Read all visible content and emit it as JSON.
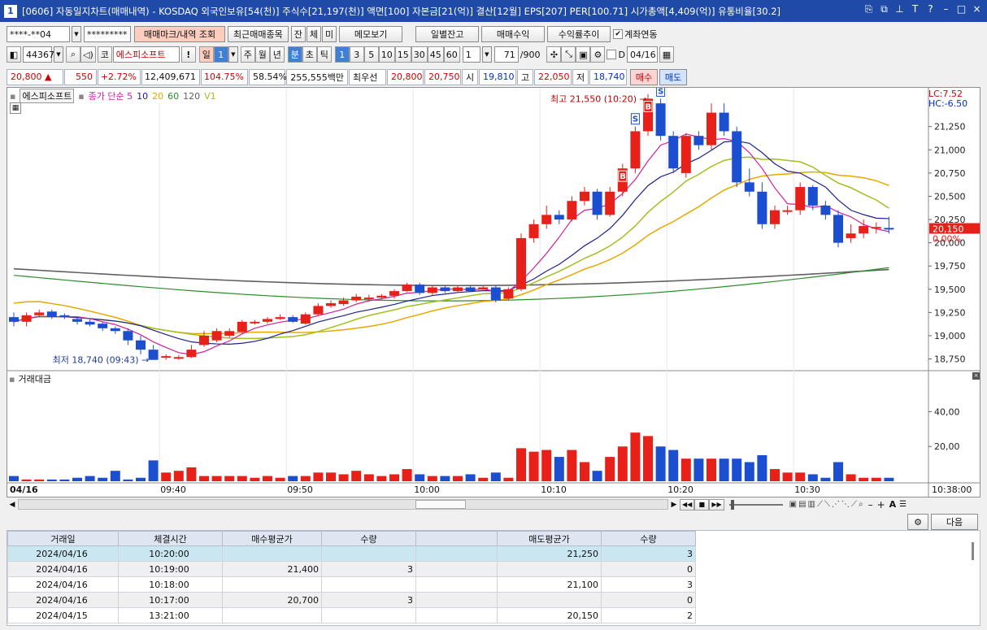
{
  "window": {
    "title": "[0606] 자동일지차트(매매내역) - KOSDAQ 외국인보유[54(천)] 주식수[21,197(천)] 액면[100] 자본금[21(억)] 결산[12월] EPS[207] PER[100.71] 시가총액[4,409(억)] 유통비율[30.2]",
    "num": "1",
    "ctl": [
      "⎘",
      "⧉",
      "⊥",
      "T",
      "?",
      "–",
      "□",
      "×"
    ]
  },
  "toolbar1": {
    "account": "****-**04",
    "password": "*********",
    "btn_marks": "매매마크/내역 조회",
    "btn_recent": "최근매매종목",
    "btn_jan": "잔",
    "btn_che": "체",
    "btn_mi": "미",
    "btn_memo": "메모보기",
    "btn_daily": "일별잔고",
    "btn_profit": "매매수익",
    "btn_trend": "수익률추이",
    "link_label": "계좌연동",
    "link_checked": "✔"
  },
  "toolbar2": {
    "code": "443670",
    "market": "코",
    "name": "에스피소프트",
    "excl": "!",
    "day": "일",
    "day_num": "1",
    "week": "주",
    "month": "월",
    "year": "년",
    "minute": "분",
    "sec": "초",
    "tick": "틱",
    "periods": [
      "1",
      "3",
      "5",
      "10",
      "15",
      "30",
      "45",
      "60"
    ],
    "custom": "1",
    "count": "71",
    "max": "/900",
    "d_label": "D",
    "date": "04/16"
  },
  "quote": {
    "price": "20,800 ▲",
    "change": "550",
    "rate": "+2.72%",
    "volume": "12,409,671",
    "vol_ratio": "104.75%",
    "pct": "58.54%",
    "amount": "255,555백만",
    "best_label": "최우선",
    "ask": "20,800",
    "bid": "20,750",
    "open_label": "시",
    "open": "19,810",
    "high_label": "고",
    "high": "22,050",
    "low_label": "저",
    "low": "18,740",
    "buy": "매수",
    "sell": "매도"
  },
  "legend": {
    "name": "에스피소프트",
    "close": "종가 단순 5",
    "ma10": "10",
    "ma20": "20",
    "ma60": "60",
    "ma120": "120",
    "v1": "V1",
    "lc": "LC:7.52",
    "hc": "HC:-6.50"
  },
  "chart_data": {
    "type": "candlestick",
    "x_ticks": [
      "04/16",
      "09:40",
      "09:50",
      "10:00",
      "10:10",
      "10:20",
      "10:30",
      "10:38:00"
    ],
    "y_ticks": [
      21250,
      21000,
      20750,
      20500,
      20250,
      20000,
      19750,
      19500,
      19250,
      19000,
      18750
    ],
    "ylim": [
      18650,
      21580
    ],
    "annotations": {
      "high": "최고 21,550 (10:20)",
      "low": "최저 18,740 (09:43)",
      "cur_price": "20,150",
      "cur_pct": "0.00%"
    },
    "candles": [
      [
        19200,
        19150,
        19250,
        19100
      ],
      [
        19150,
        19220,
        19250,
        19100
      ],
      [
        19220,
        19250,
        19280,
        19200
      ],
      [
        19260,
        19200,
        19280,
        19180
      ],
      [
        19220,
        19200,
        19240,
        19180
      ],
      [
        19180,
        19150,
        19200,
        19120
      ],
      [
        19150,
        19120,
        19180,
        19100
      ],
      [
        19130,
        19080,
        19150,
        19050
      ],
      [
        19080,
        19050,
        19100,
        19020
      ],
      [
        19050,
        18950,
        19080,
        18900
      ],
      [
        18950,
        18850,
        19000,
        18800
      ],
      [
        18850,
        18740,
        18900,
        18740
      ],
      [
        18780,
        18780,
        18800,
        18740
      ],
      [
        18760,
        18770,
        18790,
        18740
      ],
      [
        18770,
        18850,
        18900,
        18760
      ],
      [
        18900,
        19000,
        19050,
        18880
      ],
      [
        18950,
        19050,
        19080,
        18930
      ],
      [
        19000,
        19050,
        19080,
        18980
      ],
      [
        19040,
        19150,
        19170,
        19030
      ],
      [
        19150,
        19150,
        19170,
        19120
      ],
      [
        19150,
        19180,
        19200,
        19130
      ],
      [
        19180,
        19200,
        19230,
        19170
      ],
      [
        19200,
        19150,
        19220,
        19140
      ],
      [
        19130,
        19230,
        19250,
        19120
      ],
      [
        19230,
        19320,
        19350,
        19220
      ],
      [
        19320,
        19350,
        19380,
        19300
      ],
      [
        19340,
        19380,
        19410,
        19320
      ],
      [
        19380,
        19420,
        19450,
        19360
      ],
      [
        19400,
        19410,
        19440,
        19380
      ],
      [
        19410,
        19430,
        19450,
        19390
      ],
      [
        19430,
        19480,
        19500,
        19400
      ],
      [
        19480,
        19550,
        19570,
        19470
      ],
      [
        19550,
        19460,
        19570,
        19440
      ],
      [
        19460,
        19520,
        19540,
        19440
      ],
      [
        19520,
        19480,
        19540,
        19460
      ],
      [
        19480,
        19520,
        19540,
        19460
      ],
      [
        19520,
        19480,
        19540,
        19470
      ],
      [
        19500,
        19520,
        19540,
        19480
      ],
      [
        19520,
        19380,
        19540,
        19360
      ],
      [
        19400,
        19500,
        19520,
        19380
      ],
      [
        19500,
        20050,
        20100,
        19480
      ],
      [
        20050,
        20200,
        20250,
        20000
      ],
      [
        20200,
        20300,
        20400,
        20150
      ],
      [
        20300,
        20250,
        20350,
        20200
      ],
      [
        20250,
        20450,
        20500,
        20230
      ],
      [
        20450,
        20550,
        20600,
        20400
      ],
      [
        20550,
        20300,
        20580,
        20250
      ],
      [
        20300,
        20550,
        20600,
        20280
      ],
      [
        20550,
        20800,
        20850,
        20500
      ],
      [
        20800,
        21200,
        21250,
        20750
      ],
      [
        21200,
        21550,
        21600,
        21150
      ],
      [
        21500,
        21150,
        21550,
        21100
      ],
      [
        21150,
        20800,
        21200,
        20750
      ],
      [
        20750,
        21150,
        21180,
        20700
      ],
      [
        21150,
        21050,
        21200,
        21000
      ],
      [
        21050,
        21400,
        21500,
        21000
      ],
      [
        21400,
        21200,
        21500,
        21150
      ],
      [
        21200,
        20650,
        21250,
        20600
      ],
      [
        20650,
        20550,
        20800,
        20500
      ],
      [
        20550,
        20200,
        20650,
        20150
      ],
      [
        20200,
        20350,
        20400,
        20150
      ],
      [
        20350,
        20350,
        20400,
        20300
      ],
      [
        20350,
        20600,
        20650,
        20300
      ],
      [
        20600,
        20400,
        20620,
        20350
      ],
      [
        20400,
        20300,
        20450,
        20250
      ],
      [
        20300,
        20000,
        20350,
        19950
      ],
      [
        20050,
        20100,
        20200,
        20000
      ],
      [
        20100,
        20180,
        20250,
        20050
      ],
      [
        20170,
        20170,
        20220,
        20100
      ],
      [
        20160,
        20150,
        20280,
        20100
      ]
    ],
    "markers": [
      {
        "i": 48,
        "t": "B"
      },
      {
        "i": 50,
        "t": "B"
      },
      {
        "i": 49,
        "t": "S"
      },
      {
        "i": 51,
        "t": "S"
      }
    ],
    "volume": {
      "title": "거래대금",
      "y_ticks": [
        "40,00",
        "20,00"
      ],
      "ymax": 58,
      "values": [
        3,
        1,
        1,
        1,
        1,
        2,
        3,
        2,
        6,
        1,
        2,
        12,
        5,
        6,
        8,
        3,
        3,
        3,
        3,
        2,
        3,
        2,
        3,
        3,
        5,
        5,
        4,
        6,
        4,
        3,
        4,
        7,
        4,
        3,
        3,
        3,
        4,
        2,
        5,
        2,
        19,
        17,
        18,
        14,
        18,
        11,
        6,
        14,
        20,
        28,
        26,
        20,
        18,
        13,
        13,
        13,
        13,
        13,
        11,
        15,
        7,
        5,
        5,
        4,
        2,
        11,
        4,
        2,
        2,
        2
      ]
    }
  },
  "orders": {
    "btn_next": "다음",
    "headers": [
      "거래일",
      "체결시간",
      "매수평균가",
      "수량",
      "",
      "매도평균가",
      "수량"
    ],
    "rows": [
      [
        "2024/04/16",
        "10:20:00",
        "",
        "",
        "",
        "21,250",
        "3"
      ],
      [
        "2024/04/16",
        "10:19:00",
        "21,400",
        "3",
        "",
        "",
        "0"
      ],
      [
        "2024/04/16",
        "10:18:00",
        "",
        "",
        "",
        "21,100",
        "3"
      ],
      [
        "2024/04/16",
        "10:17:00",
        "20,700",
        "3",
        "",
        "",
        "0"
      ],
      [
        "2024/04/15",
        "13:21:00",
        "",
        "",
        "",
        "20,150",
        "2"
      ]
    ]
  },
  "colors": {
    "up": "#e8201a",
    "down": "#1c4fd0",
    "ma5": "#d020a0",
    "ma10": "#20208c",
    "ma20": "#e8a800",
    "ma60": "#2c8c2c",
    "ma120": "#606060",
    "v1": "#a0c020"
  }
}
